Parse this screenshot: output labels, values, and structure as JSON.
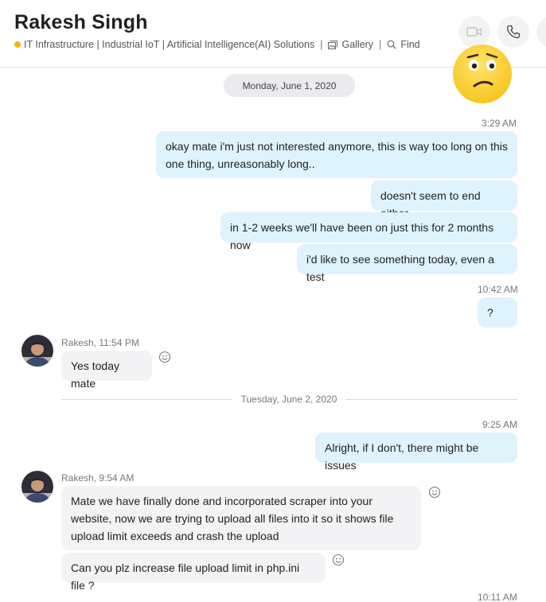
{
  "header": {
    "title": "Rakesh Singh",
    "status_color": "#f5b800",
    "subtitle": "IT Infrastructure | Industrial IoT | Artificial Intelligence(AI) Solutions",
    "separator": "|",
    "gallery_label": "Gallery",
    "find_label": "Find",
    "icons": [
      "video-call-icon",
      "phone-call-icon",
      "more-icon"
    ]
  },
  "emoji": "confused-face",
  "conversation": {
    "date1": "Monday, June 1, 2020",
    "date2": "Tuesday, June 2, 2020",
    "ts1": "3:29 AM",
    "out1": "okay mate i'm just not interested anymore, this is way too long on this one thing, unreasonably long..",
    "out2": "doesn't seem to end either",
    "out3": "in 1-2 weeks we'll have been on just this for 2 months now",
    "out4": "i'd like to see something today, even a test",
    "ts2": "10:42 AM",
    "out5": "?",
    "sender1": "Rakesh, 11:54 PM",
    "in1": "Yes today mate",
    "ts3": "9:25 AM",
    "out6": "Alright, if I don't, there might be issues",
    "sender2": "Rakesh, 9:54 AM",
    "in2": "Mate we have finally done and incorporated scraper into your website, now we are trying to upload all files into it so it shows file upload limit exceeds and crash the upload",
    "in3": "Can you plz increase file upload limit in php.ini file ?",
    "ts4": "10:11 AM"
  }
}
